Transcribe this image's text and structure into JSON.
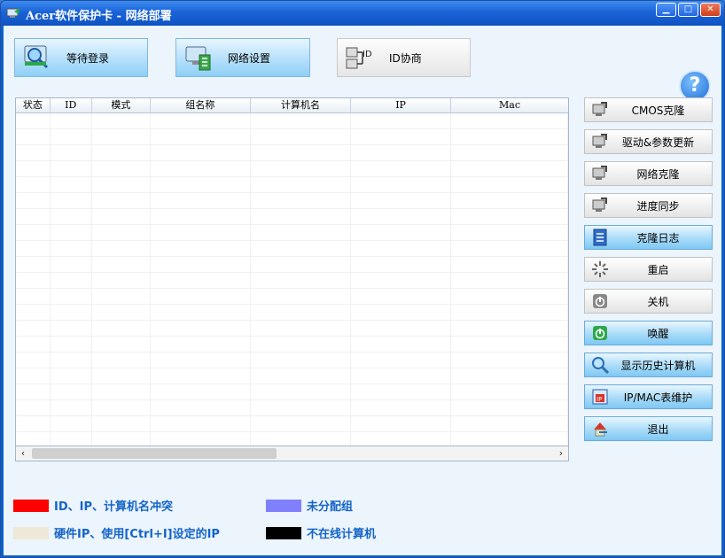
{
  "window": {
    "title": "Acer软件保护卡 - 网络部署",
    "controls": [
      "minimize",
      "maximize",
      "close"
    ]
  },
  "toolbar": {
    "buttons": [
      {
        "label": "等待登录",
        "icon": "magnifier-monitor-icon"
      },
      {
        "label": "网络设置",
        "icon": "network-computer-icon"
      },
      {
        "label": "ID协商",
        "icon": "id-network-icon"
      }
    ],
    "help_label": "?"
  },
  "table": {
    "columns": [
      "状态",
      "ID",
      "模式",
      "组名称",
      "计算机名",
      "IP",
      "Mac"
    ],
    "rows": []
  },
  "side_buttons": [
    {
      "label": "CMOS克隆",
      "icon": "computer-clone-icon",
      "active": false
    },
    {
      "label": "驱动&参数更新",
      "icon": "computer-clone-icon",
      "active": false
    },
    {
      "label": "网络克隆",
      "icon": "computer-clone-icon",
      "active": false
    },
    {
      "label": "进度同步",
      "icon": "computer-clone-icon",
      "active": false
    },
    {
      "label": "克隆日志",
      "icon": "log-icon",
      "active": true
    },
    {
      "label": "重启",
      "icon": "restart-icon",
      "active": false
    },
    {
      "label": "关机",
      "icon": "shutdown-icon",
      "active": false
    },
    {
      "label": "唤醒",
      "icon": "power-icon",
      "active": true
    },
    {
      "label": "显示历史计算机",
      "icon": "search-icon",
      "active": true
    },
    {
      "label": "IP/MAC表维护",
      "icon": "ip-table-icon",
      "active": true
    },
    {
      "label": "退出",
      "icon": "exit-icon",
      "active": true
    }
  ],
  "legend": [
    {
      "label": "ID、IP、计算机名冲突",
      "color": "#ff0000"
    },
    {
      "label": "未分配组",
      "color": "#8080ff"
    },
    {
      "label": "硬件IP、使用[Ctrl+I]设定的IP",
      "color": "#ede8d8"
    },
    {
      "label": "不在线计算机",
      "color": "#000000"
    }
  ]
}
